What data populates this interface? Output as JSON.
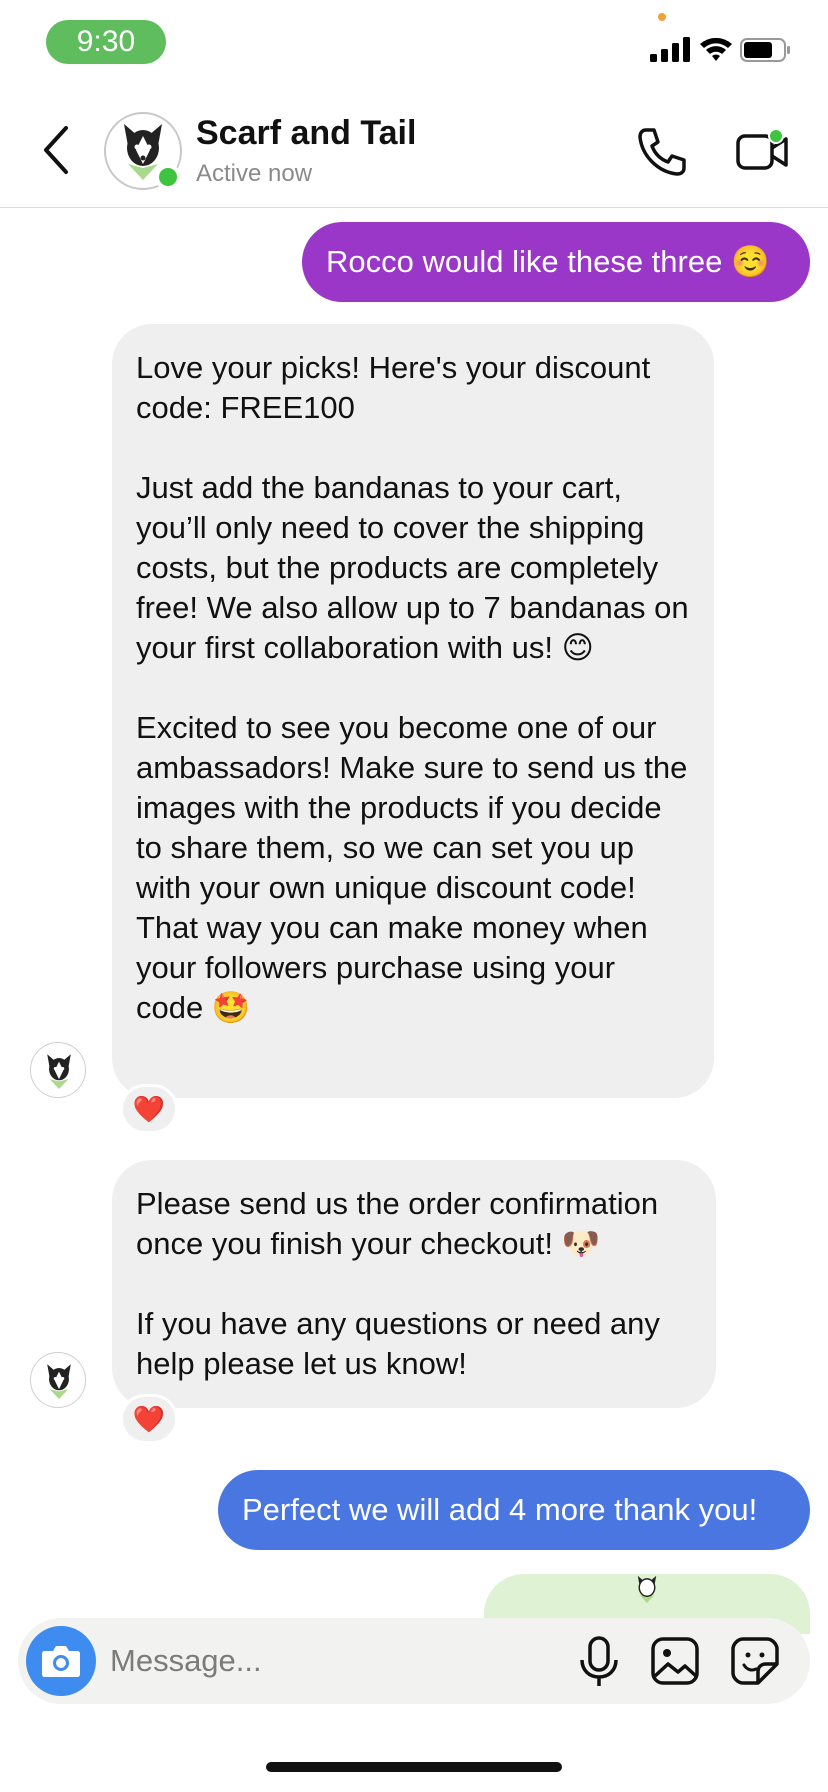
{
  "status_bar": {
    "time": "9:30",
    "icons": [
      "signal-icon",
      "wifi-icon",
      "battery-icon"
    ]
  },
  "header": {
    "back_icon": "chevron-left-icon",
    "contact_name": "Scarf and Tail",
    "contact_status": "Active now",
    "actions": [
      "phone-icon",
      "video-camera-icon"
    ]
  },
  "messages": [
    {
      "sender": "me",
      "text": "Rocco would like these three ☺️",
      "color": "#9a36c8"
    },
    {
      "sender": "Scarf and Tail",
      "text": "Love your picks! Here's your discount code: FREE100\n\nJust add the bandanas to your cart, you’ll only need to cover the shipping costs, but the products are completely free! We also allow up to 7 bandanas on your first collaboration with us! 😊\n\nExcited to see you become one of our ambassadors! Make sure to send us the images with the products if you decide to share them, so we can set you up with your own unique discount code! That way you can make money when your followers purchase using your code 🤩",
      "reaction": "❤️"
    },
    {
      "sender": "Scarf and Tail",
      "text": "Please send us the order confirmation once you finish your checkout! 🐶\n\nIf you have any questions or need any help please let us know!",
      "reaction": "❤️"
    },
    {
      "sender": "me",
      "text": "Perfect we will add 4 more thank you!",
      "color": "#4a76e2"
    }
  ],
  "composer": {
    "placeholder": "Message...",
    "icons": [
      "camera-icon",
      "microphone-icon",
      "gallery-icon",
      "sticker-icon"
    ],
    "accent": "#3f8cf0"
  },
  "colors": {
    "active_dot": "#3fc43f",
    "received_bubble": "#efefef"
  }
}
